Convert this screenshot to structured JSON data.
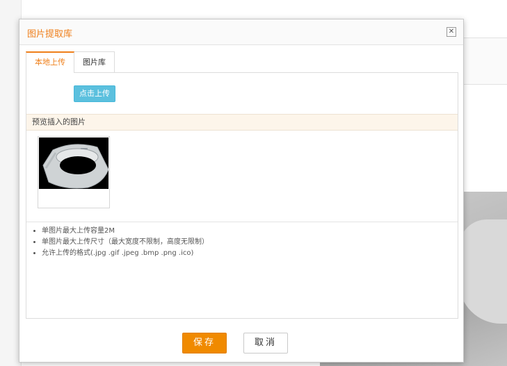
{
  "dialog": {
    "title": "图片提取库",
    "close_icon": "close-icon"
  },
  "tabs": [
    {
      "label": "本地上传",
      "active": true
    },
    {
      "label": "图片库",
      "active": false
    }
  ],
  "upload": {
    "button_label": "点击上传"
  },
  "preview": {
    "heading": "预览插入的图片",
    "thumbnails": [
      {
        "alt": "filter-bag-ring"
      }
    ]
  },
  "rules": [
    "单图片最大上传容量2M",
    "单图片最大上传尺寸（最大宽度不限制，高度无限制）",
    "允许上传的格式(.jpg .gif .jpeg .bmp .png .ico)"
  ],
  "footer": {
    "save_label": "保存",
    "cancel_label": "取消"
  },
  "colors": {
    "accent": "#ef7f1a",
    "upload_button": "#5bc0de",
    "save_button": "#f08a00"
  }
}
